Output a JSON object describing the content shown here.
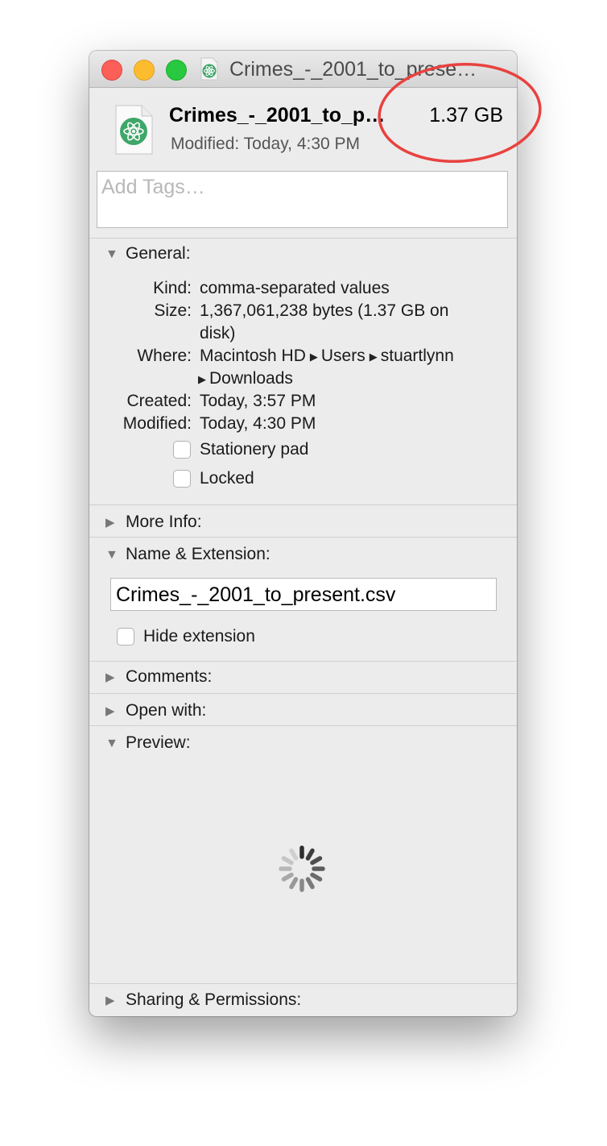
{
  "window": {
    "title": "Crimes_-_2001_to_prese…"
  },
  "header": {
    "file_name": "Crimes_-_2001_to_p…",
    "file_size": "1.37 GB",
    "modified": "Modified: Today, 4:30 PM",
    "icon": "atom-file-icon"
  },
  "tags": {
    "placeholder": "Add Tags…"
  },
  "general": {
    "label": "General:",
    "kind_label": "Kind:",
    "kind_value": "comma-separated values",
    "size_label": "Size:",
    "size_value_1": "1,367,061,238 bytes (1.37 GB on",
    "size_value_2": "disk)",
    "where_label": "Where:",
    "where_path": [
      "Macintosh HD",
      "Users",
      "stuartlynn",
      "Downloads"
    ],
    "created_label": "Created:",
    "created_value": "Today, 3:57 PM",
    "modified_label": "Modified:",
    "modified_value": "Today, 4:30 PM",
    "stationery_label": "Stationery pad",
    "locked_label": "Locked"
  },
  "sections": {
    "more_info": "More Info:",
    "name_extension": "Name & Extension:",
    "comments": "Comments:",
    "open_with": "Open with:",
    "preview": "Preview:",
    "sharing": "Sharing & Permissions:"
  },
  "name_extension": {
    "file_name_value": "Crimes_-_2001_to_present.csv",
    "hide_extension_label": "Hide extension"
  },
  "colors": {
    "close": "#fc5f57",
    "minimize": "#fdbc2e",
    "zoom": "#28c840",
    "annotation_circle": "#e8423f",
    "atom_green": "#4caf6e"
  }
}
